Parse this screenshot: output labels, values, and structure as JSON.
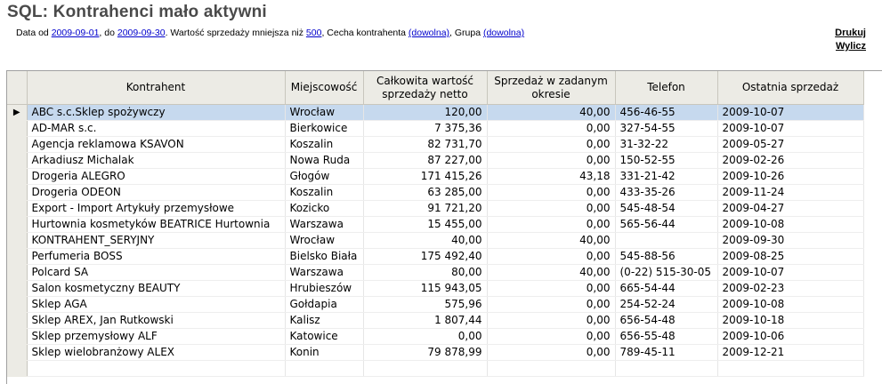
{
  "title": "SQL: Kontrahenci mało aktywni",
  "filters": {
    "date_from_label": "Data od ",
    "date_from": "2009-09-01",
    "date_to_label": ", do ",
    "date_to": "2009-09-30",
    "value_label": ". Wartość sprzedaży mniejsza niż ",
    "value": "500",
    "feature_label": ", Cecha kontrahenta ",
    "feature": "(dowolna)",
    "group_label": ", Grupa ",
    "group": "(dowolna)"
  },
  "actions": {
    "print": "Drukuj",
    "calculate": "Wylicz"
  },
  "table": {
    "selected_indicator": "▶",
    "headers": {
      "kontrahent": "Kontrahent",
      "miejscowosc": "Miejscowość",
      "wartosc_1": "Całkowita wartość",
      "wartosc_2": "sprzedaży netto",
      "sprzedaz_1": "Sprzedaż w zadanym",
      "sprzedaz_2": "okresie",
      "telefon": "Telefon",
      "ostatnia": "Ostatnia sprzedaż"
    },
    "rows": [
      {
        "kontrahent": "ABC s.c.Sklep spożywczy",
        "miejscowosc": "Wrocław",
        "wartosc": "120,00",
        "sprzedaz": "40,00",
        "telefon": "456-46-55",
        "ostatnia": "2009-10-07"
      },
      {
        "kontrahent": "AD-MAR s.c.",
        "miejscowosc": "Bierkowice",
        "wartosc": "7 375,36",
        "sprzedaz": "0,00",
        "telefon": "327-54-55",
        "ostatnia": "2009-10-07"
      },
      {
        "kontrahent": "Agencja reklamowa KSAVON",
        "miejscowosc": "Koszalin",
        "wartosc": "82 731,70",
        "sprzedaz": "0,00",
        "telefon": "31-32-22",
        "ostatnia": "2009-05-27"
      },
      {
        "kontrahent": "Arkadiusz Michalak",
        "miejscowosc": "Nowa Ruda",
        "wartosc": "87 227,00",
        "sprzedaz": "0,00",
        "telefon": "150-52-55",
        "ostatnia": "2009-02-26"
      },
      {
        "kontrahent": "Drogeria ALEGRO",
        "miejscowosc": "Głogów",
        "wartosc": "171 415,26",
        "sprzedaz": "43,18",
        "telefon": "331-21-42",
        "ostatnia": "2009-10-26"
      },
      {
        "kontrahent": "Drogeria ODEON",
        "miejscowosc": "Koszalin",
        "wartosc": "63 285,00",
        "sprzedaz": "0,00",
        "telefon": "433-35-26",
        "ostatnia": "2009-11-24"
      },
      {
        "kontrahent": "Export - Import Artykuły przemysłowe",
        "miejscowosc": "Kozicko",
        "wartosc": "91 721,20",
        "sprzedaz": "0,00",
        "telefon": "545-48-54",
        "ostatnia": "2009-04-27"
      },
      {
        "kontrahent": "Hurtownia kosmetyków BEATRICE Hurtownia",
        "miejscowosc": "Warszawa",
        "wartosc": "15 455,00",
        "sprzedaz": "0,00",
        "telefon": "565-56-44",
        "ostatnia": "2009-10-08"
      },
      {
        "kontrahent": "KONTRAHENT_SERYJNY",
        "miejscowosc": "Wrocław",
        "wartosc": "40,00",
        "sprzedaz": "40,00",
        "telefon": "",
        "ostatnia": "2009-09-30"
      },
      {
        "kontrahent": "Perfumeria BOSS",
        "miejscowosc": "Bielsko Biała",
        "wartosc": "175 492,40",
        "sprzedaz": "0,00",
        "telefon": "545-88-56",
        "ostatnia": "2009-08-25"
      },
      {
        "kontrahent": "Polcard SA",
        "miejscowosc": "Warszawa",
        "wartosc": "80,00",
        "sprzedaz": "40,00",
        "telefon": "(0-22) 515-30-05",
        "ostatnia": "2009-10-07"
      },
      {
        "kontrahent": "Salon kosmetyczny BEAUTY",
        "miejscowosc": "Hrubieszów",
        "wartosc": "115 943,05",
        "sprzedaz": "0,00",
        "telefon": "665-54-44",
        "ostatnia": "2009-02-23"
      },
      {
        "kontrahent": "Sklep AGA",
        "miejscowosc": "Gołdapia",
        "wartosc": "575,96",
        "sprzedaz": "0,00",
        "telefon": "254-52-24",
        "ostatnia": "2009-10-08"
      },
      {
        "kontrahent": "Sklep AREX, Jan Rutkowski",
        "miejscowosc": "Kalisz",
        "wartosc": "1 807,44",
        "sprzedaz": "0,00",
        "telefon": "656-54-48",
        "ostatnia": "2009-10-18"
      },
      {
        "kontrahent": "Sklep przemysłowy ALF",
        "miejscowosc": "Katowice",
        "wartosc": "0,00",
        "sprzedaz": "0,00",
        "telefon": "656-55-48",
        "ostatnia": "2009-10-06"
      },
      {
        "kontrahent": "Sklep wielobranżowy  ALEX",
        "miejscowosc": "Konin",
        "wartosc": "79 878,99",
        "sprzedaz": "0,00",
        "telefon": "789-45-11",
        "ostatnia": "2009-12-21"
      }
    ]
  }
}
